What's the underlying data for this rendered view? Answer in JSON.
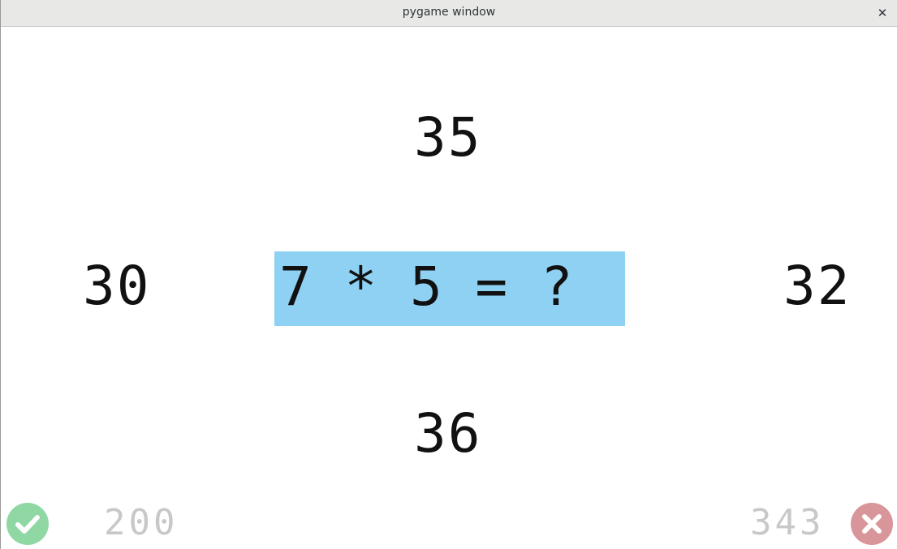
{
  "window": {
    "title": "pygame window",
    "close_label": "✕"
  },
  "question": {
    "text": "7 * 5 = ?",
    "box_color": "#8fd1f3"
  },
  "answers": {
    "top": "35",
    "left": "30",
    "right": "32",
    "bottom": "36"
  },
  "scores": {
    "correct": "200",
    "wrong": "343"
  },
  "icons": {
    "correct": "check-icon",
    "wrong": "cross-icon",
    "correct_color": "#8fd8a4",
    "wrong_color": "#d8959a"
  }
}
